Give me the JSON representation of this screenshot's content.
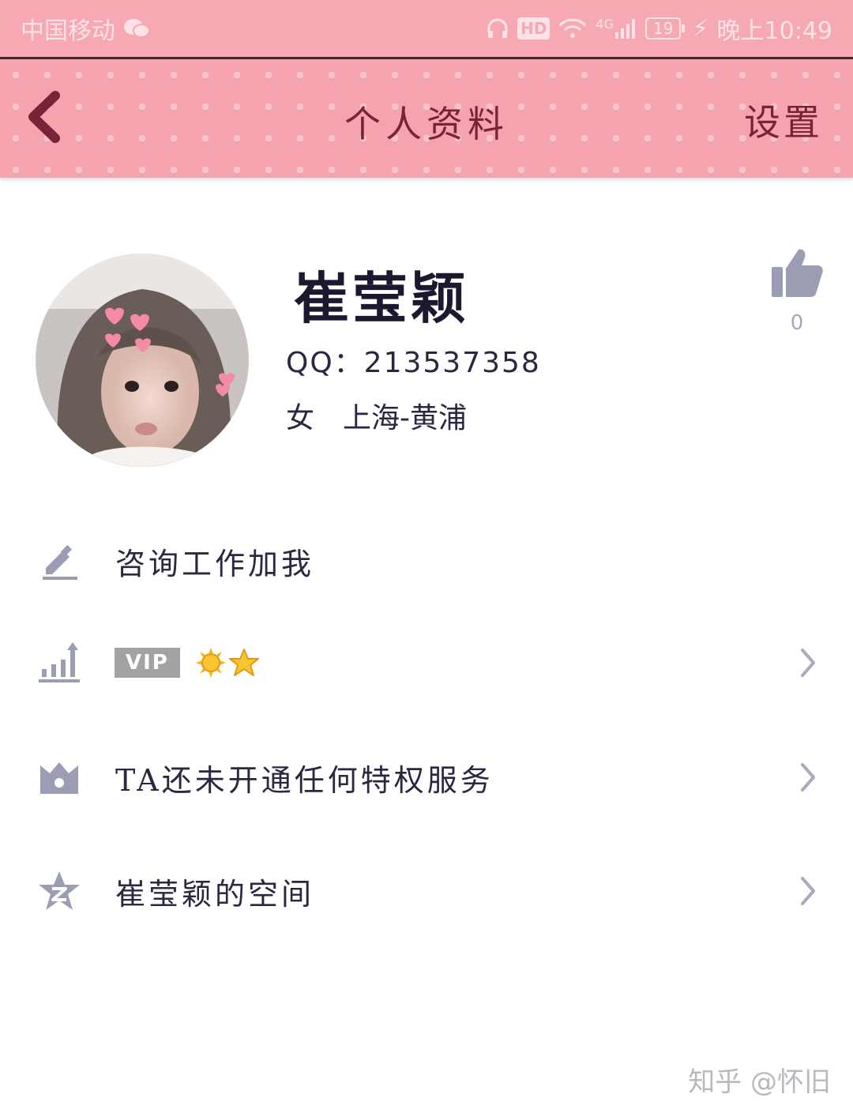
{
  "status_bar": {
    "carrier": "中国移动",
    "network": "4G",
    "hd_label": "HD",
    "battery": "19",
    "time": "晚上10:49"
  },
  "nav": {
    "back_icon": "chevron-left-icon",
    "title": "个人资料",
    "settings_label": "设置"
  },
  "profile": {
    "name": "崔莹颖",
    "qq": "QQ：213537358",
    "gender": "女",
    "location": "上海-黄浦",
    "like_count": "0"
  },
  "rows": [
    {
      "icon": "pencil-icon",
      "label": "咨询工作加我"
    },
    {
      "icon": "level-chart-icon",
      "vip_label": "VIP",
      "level_badges": [
        "sun",
        "star"
      ]
    },
    {
      "icon": "crown-icon",
      "label": "TA还未开通任何特权服务"
    },
    {
      "icon": "qzone-star-icon",
      "label": "崔莹颖的空间"
    }
  ],
  "watermark": "知乎 @怀旧",
  "colors": {
    "header_pink": "#f4a3af",
    "title_color": "#7a2338",
    "icon_gray": "#9a9db4"
  }
}
